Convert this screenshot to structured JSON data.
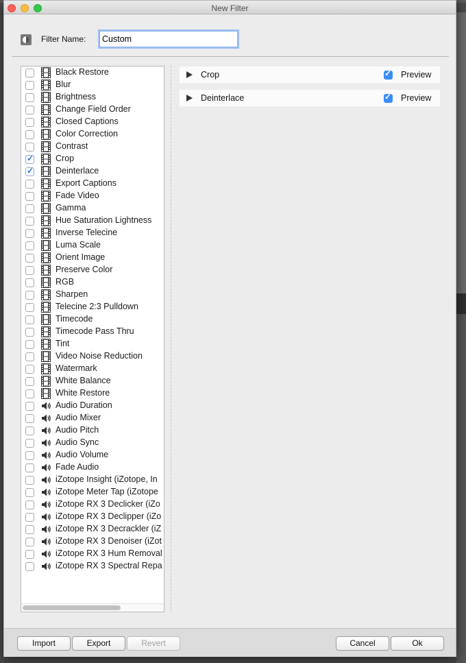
{
  "window": {
    "title": "New Filter"
  },
  "filter_name": {
    "label": "Filter Name:",
    "value": "Custom"
  },
  "filters_list": [
    {
      "label": "Black Restore",
      "checked": false,
      "icon": "film-icon"
    },
    {
      "label": "Blur",
      "checked": false,
      "icon": "film-icon"
    },
    {
      "label": "Brightness",
      "checked": false,
      "icon": "film-icon"
    },
    {
      "label": "Change Field Order",
      "checked": false,
      "icon": "film-icon"
    },
    {
      "label": "Closed Captions",
      "checked": false,
      "icon": "film-icon"
    },
    {
      "label": "Color Correction",
      "checked": false,
      "icon": "film-icon"
    },
    {
      "label": "Contrast",
      "checked": false,
      "icon": "film-icon"
    },
    {
      "label": "Crop",
      "checked": true,
      "icon": "film-icon"
    },
    {
      "label": "Deinterlace",
      "checked": true,
      "icon": "film-icon"
    },
    {
      "label": "Export Captions",
      "checked": false,
      "icon": "film-icon"
    },
    {
      "label": "Fade Video",
      "checked": false,
      "icon": "film-icon"
    },
    {
      "label": "Gamma",
      "checked": false,
      "icon": "film-icon"
    },
    {
      "label": "Hue Saturation Lightness",
      "checked": false,
      "icon": "film-icon"
    },
    {
      "label": "Inverse Telecine",
      "checked": false,
      "icon": "film-icon"
    },
    {
      "label": "Luma Scale",
      "checked": false,
      "icon": "film-icon"
    },
    {
      "label": "Orient Image",
      "checked": false,
      "icon": "film-icon"
    },
    {
      "label": "Preserve Color",
      "checked": false,
      "icon": "film-icon"
    },
    {
      "label": "RGB",
      "checked": false,
      "icon": "film-icon"
    },
    {
      "label": "Sharpen",
      "checked": false,
      "icon": "film-icon"
    },
    {
      "label": "Telecine 2:3 Pulldown",
      "checked": false,
      "icon": "film-icon"
    },
    {
      "label": "Timecode",
      "checked": false,
      "icon": "film-icon"
    },
    {
      "label": "Timecode Pass Thru",
      "checked": false,
      "icon": "film-icon"
    },
    {
      "label": "Tint",
      "checked": false,
      "icon": "film-icon"
    },
    {
      "label": "Video Noise Reduction",
      "checked": false,
      "icon": "film-icon"
    },
    {
      "label": "Watermark",
      "checked": false,
      "icon": "film-icon"
    },
    {
      "label": "White Balance",
      "checked": false,
      "icon": "film-icon"
    },
    {
      "label": "White Restore",
      "checked": false,
      "icon": "film-icon"
    },
    {
      "label": "Audio Duration",
      "checked": false,
      "icon": "speaker-icon"
    },
    {
      "label": "Audio Mixer",
      "checked": false,
      "icon": "speaker-icon"
    },
    {
      "label": "Audio Pitch",
      "checked": false,
      "icon": "speaker-icon"
    },
    {
      "label": "Audio Sync",
      "checked": false,
      "icon": "speaker-icon"
    },
    {
      "label": "Audio Volume",
      "checked": false,
      "icon": "speaker-icon"
    },
    {
      "label": "Fade Audio",
      "checked": false,
      "icon": "speaker-icon"
    },
    {
      "label": "iZotope Insight (iZotope, In",
      "checked": false,
      "icon": "speaker-icon"
    },
    {
      "label": "iZotope Meter Tap (iZotope",
      "checked": false,
      "icon": "speaker-icon"
    },
    {
      "label": "iZotope RX 3 Declicker (iZo",
      "checked": false,
      "icon": "speaker-icon"
    },
    {
      "label": "iZotope RX 3 Declipper (iZo",
      "checked": false,
      "icon": "speaker-icon"
    },
    {
      "label": "iZotope RX 3 Decrackler (iZ",
      "checked": false,
      "icon": "speaker-icon"
    },
    {
      "label": "iZotope RX 3 Denoiser (iZot",
      "checked": false,
      "icon": "speaker-icon"
    },
    {
      "label": "iZotope RX 3 Hum Removal",
      "checked": false,
      "icon": "speaker-icon"
    },
    {
      "label": "iZotope RX 3 Spectral Repa",
      "checked": false,
      "icon": "speaker-icon"
    }
  ],
  "active_filters": [
    {
      "name": "Crop",
      "preview_label": "Preview",
      "preview_checked": true
    },
    {
      "name": "Deinterlace",
      "preview_label": "Preview",
      "preview_checked": true
    }
  ],
  "buttons": {
    "import": "Import",
    "export": "Export",
    "revert": "Revert",
    "cancel": "Cancel",
    "ok": "Ok"
  },
  "colors": {
    "checkbox_accent": "#3b8df6",
    "focus_ring": "#9ec0f0"
  }
}
